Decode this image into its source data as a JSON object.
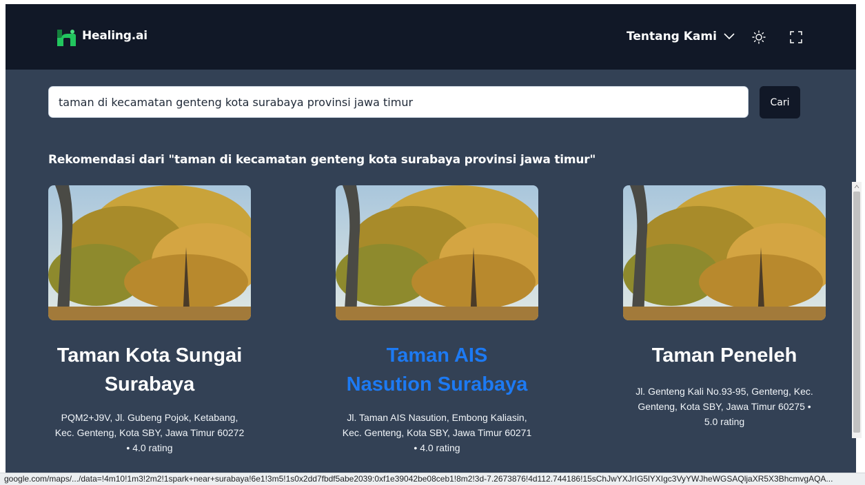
{
  "header": {
    "brand": "Healing.ai",
    "menu_label": "Tentang Kami",
    "accent_color": "#22c55e"
  },
  "search": {
    "value": "taman di kecamatan genteng kota surabaya provinsi jawa timur",
    "button_label": "Cari"
  },
  "results": {
    "heading": "Rekomendasi dari \"taman di kecamatan genteng kota surabaya provinsi jawa timur\"",
    "cards": [
      {
        "title_line1": "Taman Kota Sungai",
        "title_line2": "Surabaya",
        "address_line1": "PQM2+J9V, Jl. Gubeng Pojok, Ketabang,",
        "address_line2": "Kec. Genteng, Kota SBY, Jawa Timur 60272",
        "address_line3": "• 4.0 rating"
      },
      {
        "title_line1": "Taman AIS",
        "title_line2": "Nasution Surabaya",
        "address_line1": "Jl. Taman AIS Nasution, Embong Kaliasin,",
        "address_line2": "Kec. Genteng, Kota SBY, Jawa Timur 60271",
        "address_line3": "• 4.0 rating",
        "title_color": "#1d7af3"
      },
      {
        "title_line1": "Taman Peneleh",
        "address_line1": "Jl. Genteng Kali No.93-95, Genteng, Kec.",
        "address_line2": "Genteng, Kota SBY, Jawa Timur 60275 •",
        "address_line3": "5.0 rating"
      }
    ]
  },
  "status_bar": {
    "url": "google.com/maps/.../data=!4m10!1m3!2m2!1spark+near+surabaya!6e1!3m5!1s0x2dd7fbdf5abe2039:0xf1e39042be08ceb1!8m2!3d-7.2673876!4d112.744186!15sChJwYXJrIG5lYXIgc3VyYWJheWGSAQljaXR5X3BhcmvgAQA..."
  }
}
